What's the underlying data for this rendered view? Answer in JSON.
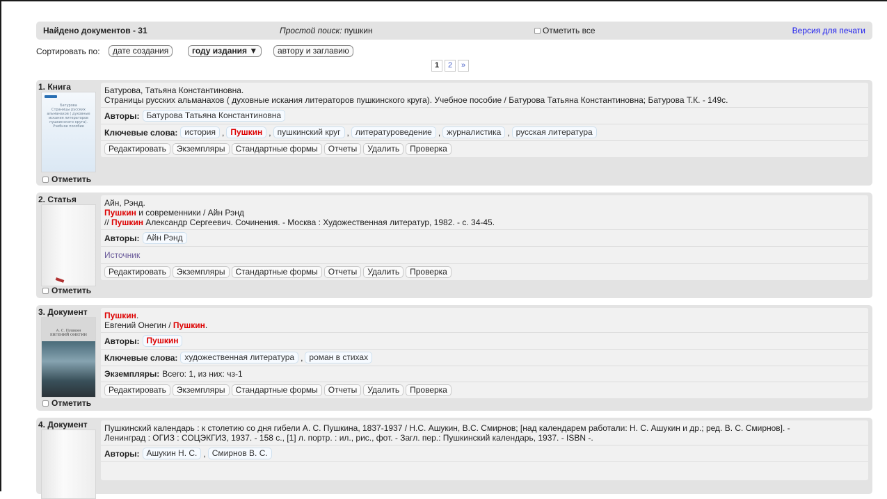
{
  "header": {
    "found": "Найдено документов - 31",
    "simple_search_label": "Простой поиск:",
    "simple_search_value": " пушкин",
    "mark_all": "Отметить все",
    "print_version": "Версия для печати"
  },
  "sort": {
    "label": "Сортировать по:",
    "options": [
      "дате создания",
      "году издания ▼",
      "автору и заглавию"
    ],
    "active_index": 1
  },
  "pagination": {
    "pages": [
      "1",
      "2",
      "»"
    ],
    "current": "1"
  },
  "labels": {
    "authors": "Авторы:",
    "keywords": "Ключевые слова:",
    "copies": "Экземпляры:",
    "mark": "Отметить"
  },
  "actions": [
    "Редактировать",
    "Экземпляры",
    "Стандартные формы",
    "Отчеты",
    "Удалить",
    "Проверка"
  ],
  "records": [
    {
      "kind": "1. Книга",
      "cover_text": "Батурова\nСтраницы русских альманахов ( духовные искания литераторов пушкинского круга). Учебное пособие",
      "line1": "Батурова, Татьяна Константиновна.",
      "line2": "Страницы русских альманахов ( духовные искания литераторов пушкинского круга). Учебное пособие / Батурова Татьяна Константиновна; Батурова Т.К. - 149с.",
      "authors": [
        "Батурова Татьяна Константиновна"
      ],
      "keywords": [
        "история",
        "Пушкин",
        "пушкинский круг",
        "литературоведение",
        "журналистика",
        "русская литература"
      ]
    },
    {
      "kind": "2. Статья",
      "line1": "Айн, Рэнд.",
      "line2_hl": "Пушкин",
      "line2_rest": " и современники / Айн Рэнд",
      "line3_pre": "// ",
      "line3_hl": "Пушкин",
      "line3_rest": " Александр Сергеевич. Сочинения. - Москва : Художественная литератур, 1982. - с. 34-45.",
      "authors": [
        "Айн Рэнд"
      ],
      "source": "Источник"
    },
    {
      "kind": "3. Документ",
      "cover_text": "А. С. Пушкин\nЕВГЕНИЙ ОНЕГИН",
      "line1_hl": "Пушкин",
      "line1_rest": ".",
      "line2_pre": "Евгений Онегин / ",
      "line2_hl": "Пушкин",
      "line2_rest": ".",
      "authors": [
        "Пушкин"
      ],
      "keywords": [
        "художественная литература",
        "роман в стихах"
      ],
      "copies": "Всего: 1, из них: чз-1"
    },
    {
      "kind": "4. Документ",
      "line1": "Пушкинский календарь : к столетию со дня гибели А. С. Пушкина, 1837-1937 / Н.С. Ашукин, В.С. Смирнов; [над календарем работали: Н. С. Ашукин и др.; ред. В. С. Смирнов]. -",
      "line2": "Ленинград : ОГИЗ : СОЦЭКГИЗ, 1937. - 158 с., [1] л. портр. : ил., рис., фот. - Загл. пер.: Пушкинский календарь, 1937. - ISBN -.",
      "authors": [
        "Ашукин Н. С.",
        "Смирнов В. С."
      ]
    }
  ]
}
